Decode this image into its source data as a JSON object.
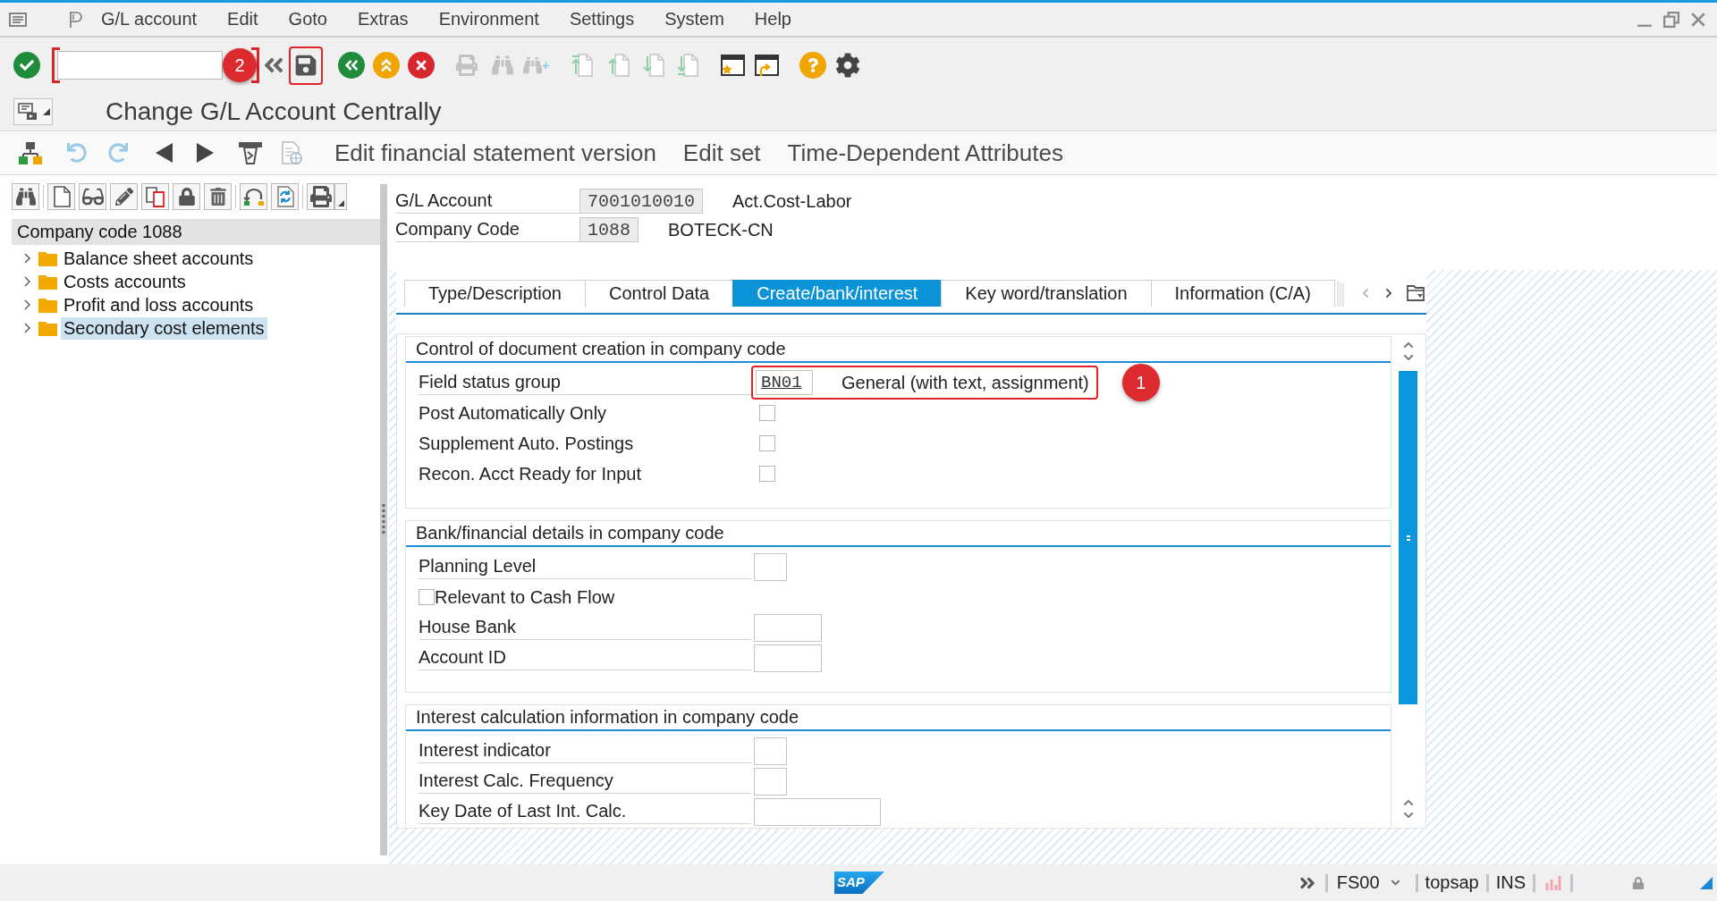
{
  "menu_bar": {
    "items": [
      "G/L account",
      "Edit",
      "Goto",
      "Extras",
      "Environment",
      "Settings",
      "System",
      "Help"
    ]
  },
  "toolbar": {
    "command_field": {
      "highlighted": true
    },
    "save_button": {
      "highlighted": true,
      "callout": "2"
    }
  },
  "title": "Change G/L Account Centrally",
  "app_toolbar": {
    "buttons": [
      "Edit financial statement version",
      "Edit set",
      "Time-Dependent Attributes"
    ]
  },
  "tree": {
    "root": "Company code 1088",
    "items": [
      {
        "label": "Balance sheet accounts",
        "expanded": false,
        "selected": false
      },
      {
        "label": "Costs accounts",
        "expanded": false,
        "selected": false
      },
      {
        "label": "Profit and loss accounts",
        "expanded": false,
        "selected": false
      },
      {
        "label": "Secondary cost elements",
        "expanded": false,
        "selected": true
      }
    ]
  },
  "header_fields": [
    {
      "label": "G/L Account",
      "value": "7001010010",
      "description": "Act.Cost-Labor"
    },
    {
      "label": "Company Code",
      "value": "1088",
      "description": "BOTECK-CN"
    }
  ],
  "tabs": [
    {
      "label": "Type/Description",
      "selected": false
    },
    {
      "label": "Control Data",
      "selected": false
    },
    {
      "label": "Create/bank/interest",
      "selected": true
    },
    {
      "label": "Key word/translation",
      "selected": false
    },
    {
      "label": "Information (C/A)",
      "selected": false
    }
  ],
  "groups": [
    {
      "title": "Control of document creation in company code",
      "fields": [
        {
          "kind": "select",
          "label": "Field status group",
          "value": "BN01",
          "description": "General (with text, assignment)",
          "highlighted": true,
          "callout": "1"
        },
        {
          "kind": "checkbox",
          "label": "Post Automatically Only",
          "checked": false
        },
        {
          "kind": "checkbox",
          "label": "Supplement Auto. Postings",
          "checked": false
        },
        {
          "kind": "checkbox",
          "label": "Recon. Acct Ready for Input",
          "checked": false
        }
      ]
    },
    {
      "title": "Bank/financial details in company code",
      "fields": [
        {
          "kind": "code",
          "label": "Planning Level"
        },
        {
          "kind": "flag",
          "label": "Relevant to Cash Flow",
          "checked": false
        },
        {
          "kind": "text",
          "label": "House Bank"
        },
        {
          "kind": "text",
          "label": "Account ID"
        }
      ]
    },
    {
      "title": "Interest calculation information in company code",
      "fields": [
        {
          "kind": "code",
          "label": "Interest indicator"
        },
        {
          "kind": "code",
          "label": "Interest Calc. Frequency"
        },
        {
          "kind": "date",
          "label": "Key Date of Last Int. Calc."
        }
      ]
    }
  ],
  "status_bar": {
    "logo": "SAP",
    "transaction": "FS00",
    "user": "topsap",
    "mode": "INS"
  }
}
